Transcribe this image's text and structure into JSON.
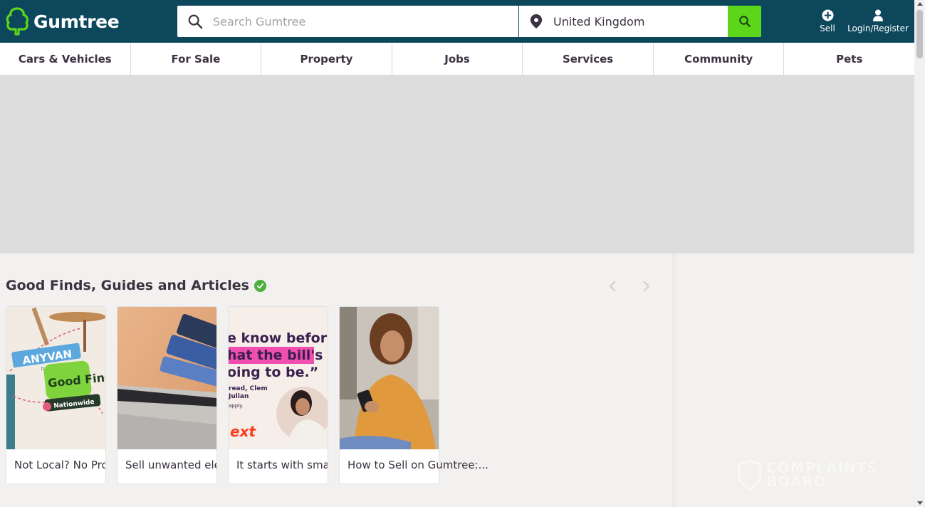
{
  "header": {
    "logo_text": "Gumtree",
    "search_placeholder": "Search Gumtree",
    "location_value": "United Kingdom",
    "sell_label": "Sell",
    "login_label": "Login/Register",
    "colors": {
      "header_bg": "#0d475c",
      "search_button": "#5cd61b",
      "logo_green": "#5cd61b"
    }
  },
  "nav": {
    "items": [
      "Cars & Vehicles",
      "For Sale",
      "Property",
      "Jobs",
      "Services",
      "Community",
      "Pets"
    ]
  },
  "articles": {
    "title": "Good Finds, Guides and Articles",
    "cards": [
      {
        "caption": "Not Local? No Prob",
        "badge_brand": "ANYVAN",
        "badge_sub": "Delivering",
        "badge_main": "Good Finds",
        "badge_tag": "Nationwide"
      },
      {
        "caption": "Sell unwanted elec"
      },
      {
        "caption": "It starts with smart",
        "quote_line1": "e know befor",
        "quote_line2": "hat the bill's",
        "quote_line3": "oing to be.”",
        "small_line1": "read, Clem",
        "small_line2": "Julian",
        "small_line3": "apply.",
        "brand": "ext"
      },
      {
        "caption": "How to Sell on Gumtree:..."
      }
    ]
  },
  "watermark": {
    "line1": "COMPLAINTS",
    "line2": "BOARD"
  }
}
